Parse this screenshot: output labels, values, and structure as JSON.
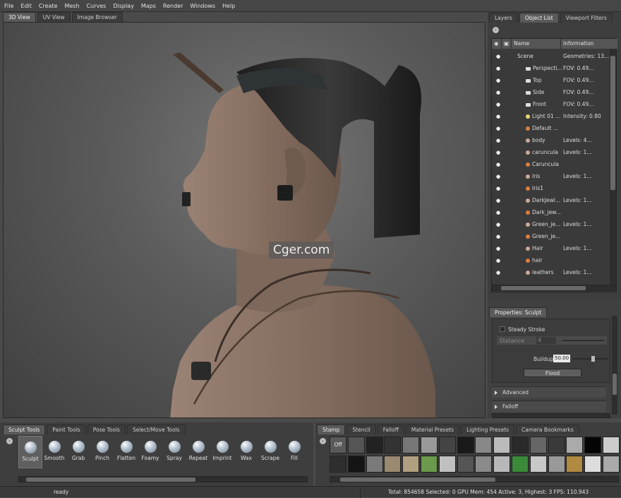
{
  "menu": [
    "File",
    "Edit",
    "Create",
    "Mesh",
    "Curves",
    "Display",
    "Maps",
    "Render",
    "Windows",
    "Help"
  ],
  "view_tabs": [
    "3D View",
    "UV View",
    "Image Browser"
  ],
  "right_tabs": [
    "Layers",
    "Object List",
    "Viewport Filters"
  ],
  "object_list": {
    "columns": [
      "Name",
      "Information"
    ],
    "rows": [
      {
        "name": "Scene",
        "info": "Geometries: 13...",
        "icon": "scene-icon",
        "indent": 0
      },
      {
        "name": "Perspecti...",
        "info": "FOV: 0.49...",
        "icon": "camera-icon",
        "indent": 1
      },
      {
        "name": "Top",
        "info": "FOV: 0.49...",
        "icon": "camera-icon",
        "indent": 1
      },
      {
        "name": "Side",
        "info": "FOV: 0.49...",
        "icon": "camera-icon",
        "indent": 1
      },
      {
        "name": "Front",
        "info": "FOV: 0.49...",
        "icon": "camera-icon",
        "indent": 1
      },
      {
        "name": "Light 01 ...",
        "info": "Intensity: 0.80",
        "icon": "light-icon",
        "indent": 1
      },
      {
        "name": "Default ...",
        "info": "",
        "icon": "material-icon",
        "indent": 1
      },
      {
        "name": "body",
        "info": "Levels: 4...",
        "icon": "mesh-icon",
        "indent": 1
      },
      {
        "name": "caruncula",
        "info": "Levels: 1...",
        "icon": "mesh-icon",
        "indent": 1
      },
      {
        "name": "Caruncula",
        "info": "",
        "icon": "material-icon",
        "indent": 1
      },
      {
        "name": "Iris",
        "info": "Levels: 1...",
        "icon": "mesh-icon",
        "indent": 1
      },
      {
        "name": "Iris1",
        "info": "",
        "icon": "material-icon",
        "indent": 1
      },
      {
        "name": "DarkJewl...",
        "info": "Levels: 1...",
        "icon": "mesh-icon",
        "indent": 1
      },
      {
        "name": "Dark_jew...",
        "info": "",
        "icon": "material-icon",
        "indent": 1
      },
      {
        "name": "Green_je...",
        "info": "Levels: 1...",
        "icon": "mesh-icon",
        "indent": 1
      },
      {
        "name": "Green_je...",
        "info": "",
        "icon": "material-icon",
        "indent": 1
      },
      {
        "name": "Hair",
        "info": "Levels: 1...",
        "icon": "mesh-icon",
        "indent": 1
      },
      {
        "name": "hair",
        "info": "",
        "icon": "material-icon",
        "indent": 1
      },
      {
        "name": "leathers",
        "info": "Levels: 1...",
        "icon": "mesh-icon",
        "indent": 1
      }
    ]
  },
  "properties": {
    "tab": "Properties: Sculpt",
    "steady_stroke": "Steady Stroke",
    "distance_label": "Distance",
    "distance_value": "4",
    "buildup_label": "Buildup",
    "buildup_value": "50.00",
    "flood": "Flood",
    "advanced": "Advanced",
    "falloff": "Falloff"
  },
  "tool_tabs": [
    "Sculpt Tools",
    "Paint Tools",
    "Pose Tools",
    "Select/Move Tools"
  ],
  "tools": [
    "Sculpt",
    "Smooth",
    "Grab",
    "Pinch",
    "Flatten",
    "Foamy",
    "Spray",
    "Repeat",
    "Imprint",
    "Wax",
    "Scrape",
    "Fill"
  ],
  "stamp_tabs": [
    "Stamp",
    "Stencil",
    "Falloff",
    "Material Presets",
    "Lighting Presets",
    "Camera Bookmarks"
  ],
  "stamp_off": "Off",
  "status": {
    "left": "ready",
    "right": "Total: 854658  Selected: 0 GPU Mem: 454  Active: 3, Highest: 3  FPS: 110.943"
  },
  "watermark": "Cger.com",
  "colors": {
    "skin": "#8a7466",
    "skin_shadow": "#5a4a40",
    "hair": "#262626",
    "leather": "#4a3a30",
    "light_bulb": "#e8d870",
    "material_orange": "#d98040",
    "active_tab": "#5a5a5a"
  }
}
